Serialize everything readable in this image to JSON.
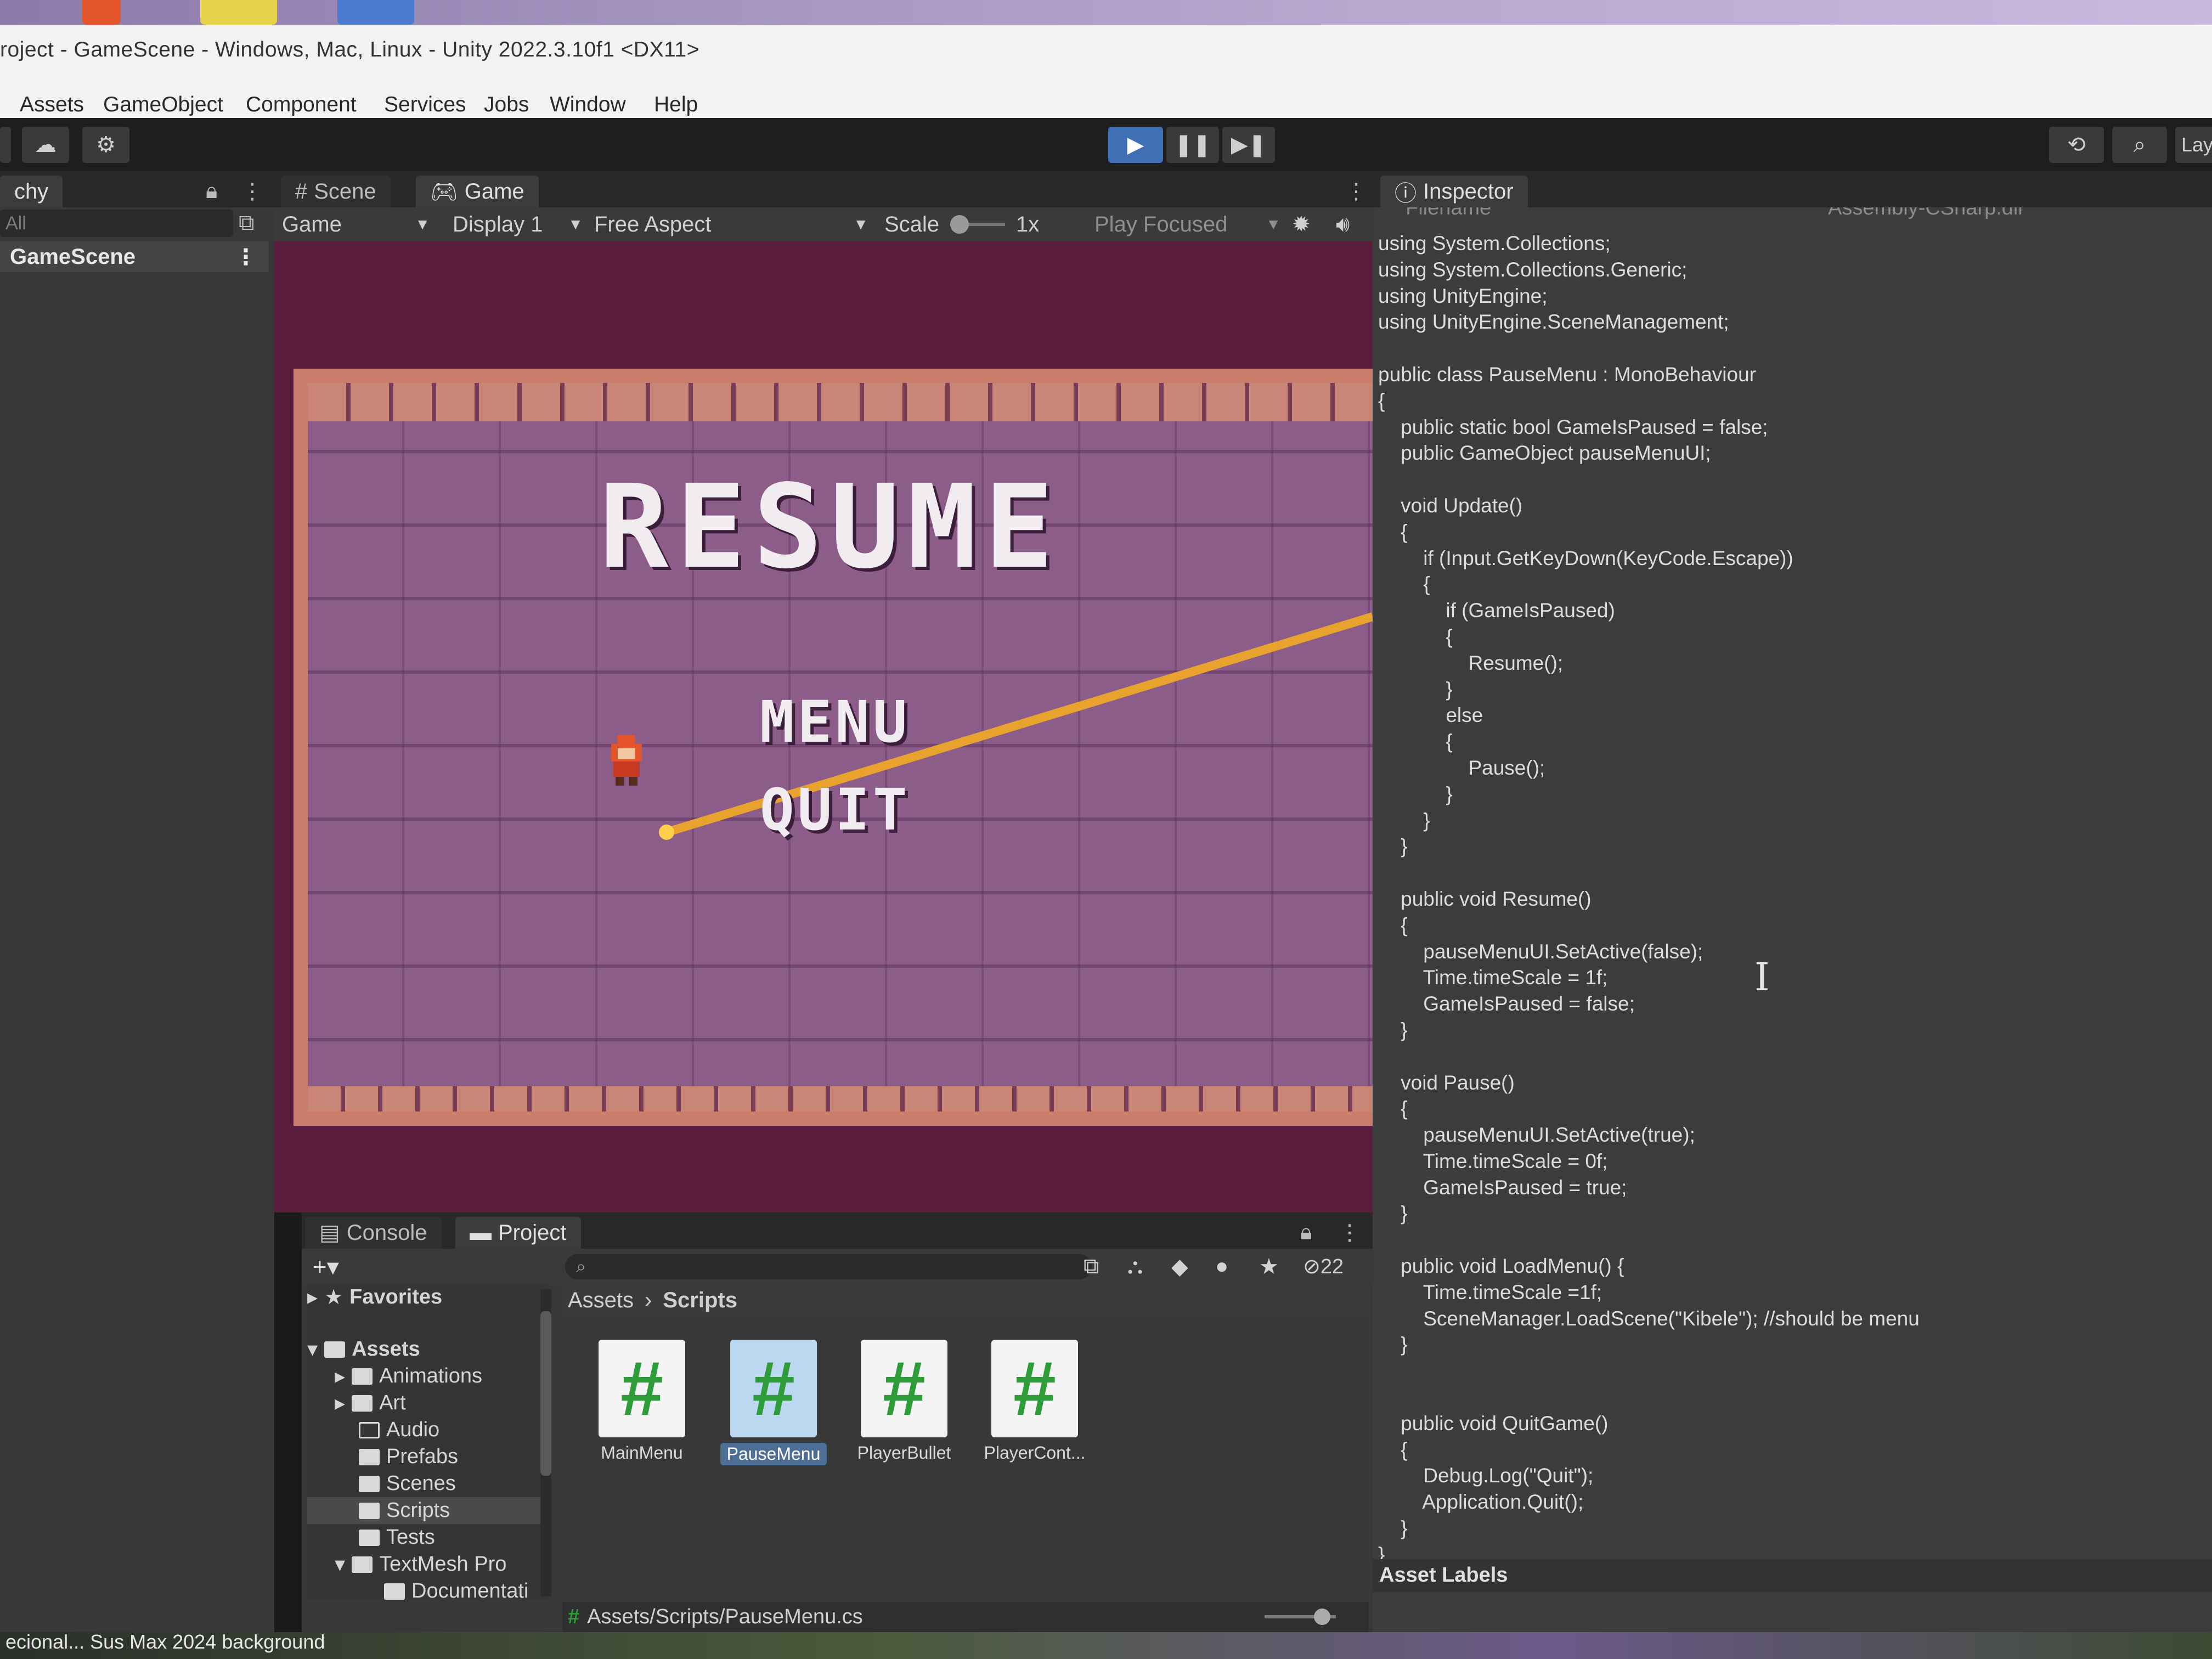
{
  "window": {
    "title": "roject - GameScene - Windows, Mac, Linux - Unity 2022.3.10f1 <DX11>"
  },
  "menu": {
    "items": [
      "Assets",
      "GameObject",
      "Component",
      "Services",
      "Jobs",
      "Window",
      "Help"
    ]
  },
  "toolbar": {
    "play_icon": "play-icon",
    "pause_icon": "pause-icon",
    "step_icon": "step-icon",
    "layout_label": "Lay"
  },
  "hierarchy": {
    "tab_label": "chy",
    "search_placeholder": "All",
    "scene_name": "GameScene"
  },
  "game_view": {
    "tabs": [
      "Scene",
      "Game"
    ],
    "view_mode": "Game",
    "display": "Display 1",
    "aspect": "Free Aspect",
    "scale_label": "Scale",
    "scale_value": "1x",
    "play_mode": "Play Focused",
    "pause_menu": {
      "resume": "RESUME",
      "menu": "MENU",
      "quit": "QUIT"
    }
  },
  "project": {
    "tabs": [
      "Console",
      "Project"
    ],
    "hidden_count": "22",
    "tree": {
      "favorites": "Favorites",
      "assets": "Assets",
      "folders": [
        "Animations",
        "Art",
        "Audio",
        "Prefabs",
        "Scenes",
        "Scripts",
        "Tests",
        "TextMesh Pro",
        "Documentati"
      ]
    },
    "breadcrumb": [
      "Assets",
      "Scripts"
    ],
    "files": [
      "MainMenu",
      "PauseMenu",
      "PlayerBullet",
      "PlayerCont..."
    ],
    "selected_file": "PauseMenu",
    "footer_path": "Assets/Scripts/PauseMenu.cs"
  },
  "inspector": {
    "tab_label": "Inspector",
    "header_left": "Filename",
    "header_right": "Assembly-CSharp.dll",
    "code": "using System.Collections;\nusing System.Collections.Generic;\nusing UnityEngine;\nusing UnityEngine.SceneManagement;\n\npublic class PauseMenu : MonoBehaviour\n{\n    public static bool GameIsPaused = false;\n    public GameObject pauseMenuUI;\n\n    void Update()\n    {\n        if (Input.GetKeyDown(KeyCode.Escape))\n        {\n            if (GameIsPaused)\n            {\n                Resume();\n            }\n            else\n            {\n                Pause();\n            }\n        }\n    }\n\n    public void Resume()\n    {\n        pauseMenuUI.SetActive(false);\n        Time.timeScale = 1f;\n        GameIsPaused = false;\n    }\n\n    void Pause()\n    {\n        pauseMenuUI.SetActive(true);\n        Time.timeScale = 0f;\n        GameIsPaused = true;\n    }\n\n    public void LoadMenu() {\n        Time.timeScale =1f;\n        SceneManager.LoadScene(\"Kibele\"); //should be menu\n    }\n\n\n    public void QuitGame()\n    {\n        Debug.Log(\"Quit\");\n        Application.Quit();\n    }\n}",
    "asset_labels": "Asset Labels"
  },
  "desktop": {
    "bottom_text": "ecional... Sus Max 2024 background"
  },
  "colors": {
    "play_accent": "#3f6fb5",
    "csharp_icon": "#2f9c3a",
    "aim_line": "#e8a32e"
  }
}
